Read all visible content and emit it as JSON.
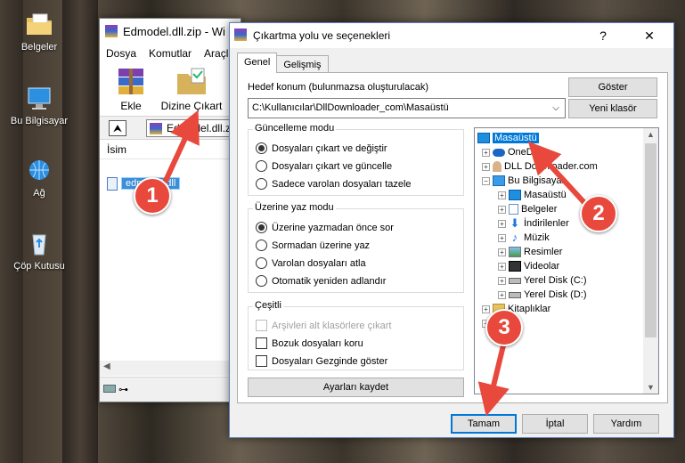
{
  "desktop": {
    "icons": [
      {
        "label": "Belgeler",
        "icon": "folder-icon"
      },
      {
        "label": "Bu Bilgisayar",
        "icon": "computer-icon"
      },
      {
        "label": "Ağ",
        "icon": "network-icon"
      },
      {
        "label": "Çöp Kutusu",
        "icon": "recycle-bin-icon"
      }
    ]
  },
  "winrar": {
    "title": "Edmodel.dll.zip - Wi",
    "menu": [
      "Dosya",
      "Komutlar",
      "Araçla"
    ],
    "tools": [
      {
        "label": "Ekle",
        "icon": "winrar-add-icon"
      },
      {
        "label": "Dizine Çıkart",
        "icon": "extract-to-icon"
      }
    ],
    "address_value": "Edmodel.dll.zip",
    "column_header": "İsim",
    "file_name": "edmodel.dll"
  },
  "dialog": {
    "title": "Çıkartma yolu ve seçenekleri",
    "help": "?",
    "close": "✕",
    "tabs": [
      "Genel",
      "Gelişmiş"
    ],
    "dest_label": "Hedef konum (bulunmazsa oluşturulacak)",
    "dest_value": "C:\\Kullanıcılar\\DllDownloader_com\\Masaüstü",
    "show_button": "Göster",
    "new_folder_button": "Yeni klasör",
    "update_mode": {
      "title": "Güncelleme modu",
      "options": [
        {
          "label": "Dosyaları çıkart ve değiştir",
          "selected": true
        },
        {
          "label": "Dosyaları çıkart ve güncelle",
          "selected": false
        },
        {
          "label": "Sadece varolan dosyaları tazele",
          "selected": false
        }
      ]
    },
    "overwrite_mode": {
      "title": "Üzerine yaz modu",
      "options": [
        {
          "label": "Üzerine yazmadan önce sor",
          "selected": true
        },
        {
          "label": "Sormadan üzerine yaz",
          "selected": false
        },
        {
          "label": "Varolan dosyaları atla",
          "selected": false
        },
        {
          "label": "Otomatik yeniden adlandır",
          "selected": false
        }
      ]
    },
    "misc": {
      "title": "Çeşitli",
      "options": [
        {
          "label": "Arşivleri alt klasörlere çıkart",
          "checked": false,
          "disabled": true
        },
        {
          "label": "Bozuk dosyaları koru",
          "checked": false,
          "disabled": false
        },
        {
          "label": "Dosyaları Gezginde göster",
          "checked": false,
          "disabled": false
        }
      ]
    },
    "save_settings_button": "Ayarları kaydet",
    "tree": [
      {
        "label": "Masaüstü",
        "icon": "desktop-icon",
        "selected": true
      },
      {
        "label": "OneDrive",
        "icon": "onedrive-icon"
      },
      {
        "label": "DLL Downloader.com",
        "icon": "user-icon"
      },
      {
        "label": "Bu Bilgisayar",
        "icon": "computer-icon"
      },
      {
        "label": "Masaüstü",
        "icon": "desktop-icon"
      },
      {
        "label": "Belgeler",
        "icon": "documents-icon"
      },
      {
        "label": "İndirilenler",
        "icon": "downloads-icon"
      },
      {
        "label": "Müzik",
        "icon": "music-icon"
      },
      {
        "label": "Resimler",
        "icon": "pictures-icon"
      },
      {
        "label": "Videolar",
        "icon": "videos-icon"
      },
      {
        "label": "Yerel Disk (C:)",
        "icon": "disk-icon"
      },
      {
        "label": "Yerel Disk (D:)",
        "icon": "disk-icon"
      },
      {
        "label": "Kitaplıklar",
        "icon": "libraries-icon"
      }
    ],
    "ok_button": "Tamam",
    "cancel_button": "İptal",
    "help_button": "Yardım"
  },
  "annotations": [
    "1",
    "2",
    "3"
  ],
  "colors": {
    "accent": "#0078d7",
    "annotation": "#e8493c",
    "selection": "#cce8ff"
  }
}
